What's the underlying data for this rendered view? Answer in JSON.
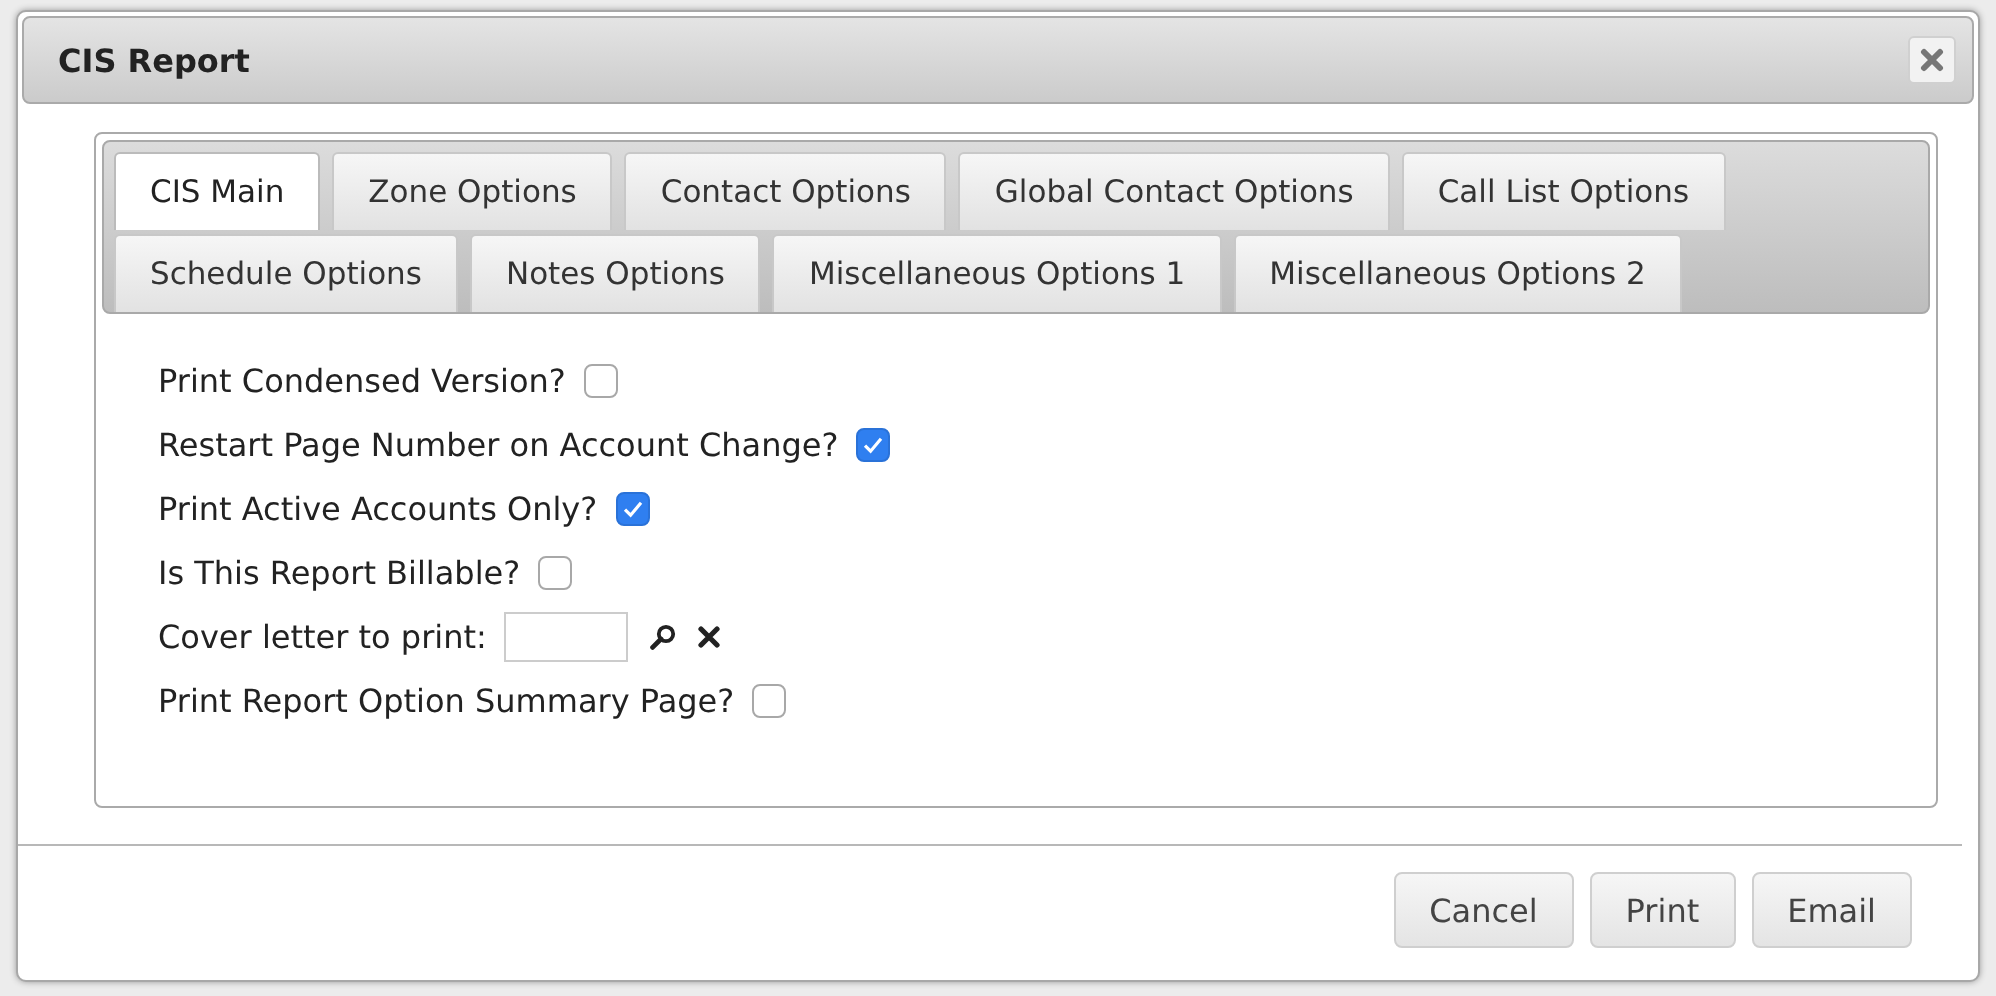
{
  "window": {
    "title": "CIS Report"
  },
  "tabs": [
    {
      "label": "CIS Main",
      "selected": true
    },
    {
      "label": "Zone Options",
      "selected": false
    },
    {
      "label": "Contact Options",
      "selected": false
    },
    {
      "label": "Global Contact Options",
      "selected": false
    },
    {
      "label": "Call List Options",
      "selected": false
    },
    {
      "label": "Schedule Options",
      "selected": false
    },
    {
      "label": "Notes Options",
      "selected": false
    },
    {
      "label": "Miscellaneous Options 1",
      "selected": false
    },
    {
      "label": "Miscellaneous Options 2",
      "selected": false
    }
  ],
  "options": [
    {
      "kind": "checkbox",
      "label": "Print Condensed Version?",
      "checked": false
    },
    {
      "kind": "checkbox",
      "label": "Restart Page Number on Account Change?",
      "checked": true
    },
    {
      "kind": "checkbox",
      "label": "Print Active Accounts Only?",
      "checked": true
    },
    {
      "kind": "checkbox",
      "label": "Is This Report Billable?",
      "checked": false
    },
    {
      "kind": "lookup",
      "label": "Cover letter to print:"
    },
    {
      "kind": "checkbox",
      "label": "Print Report Option Summary Page?",
      "checked": false
    }
  ],
  "buttons": [
    "Cancel",
    "Print",
    "Email"
  ]
}
